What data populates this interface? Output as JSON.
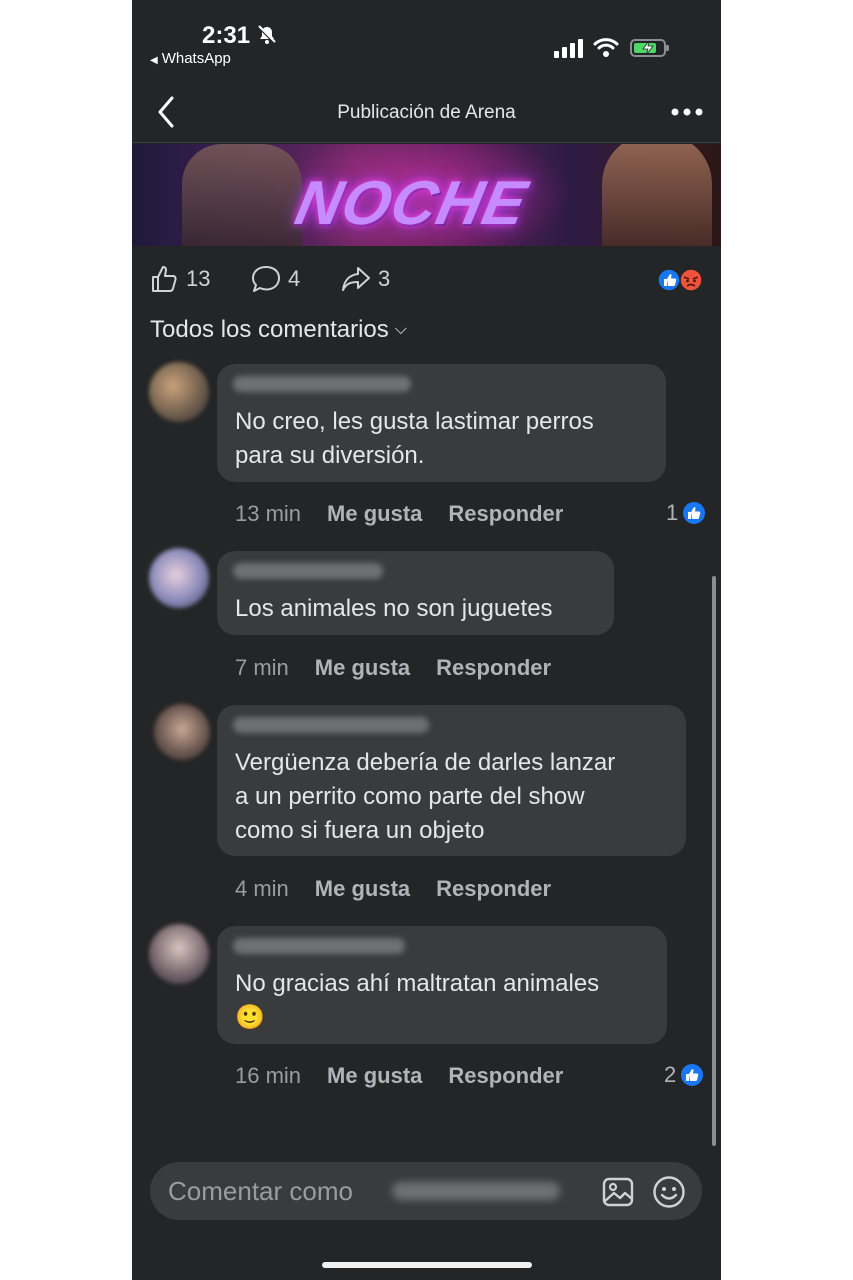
{
  "status_bar": {
    "time": "2:31",
    "back_app": "WhatsApp"
  },
  "header": {
    "title": "Publicación de Arena"
  },
  "banner": {
    "text": "NOCHE"
  },
  "stats": {
    "likes": "13",
    "comments": "4",
    "shares": "3"
  },
  "filter": {
    "label": "Todos los comentarios"
  },
  "actions": {
    "like": "Me gusta",
    "reply": "Responder"
  },
  "comments": [
    {
      "text": "No creo, les gusta lastimar perros\npara su diversión.",
      "time": "13 min",
      "likes": "1"
    },
    {
      "text": "Los animales no son juguetes",
      "time": "7 min",
      "likes": ""
    },
    {
      "text": "Vergüenza debería de darles lanzar\na un perrito como parte del show\ncomo si fuera un objeto",
      "time": "4 min",
      "likes": ""
    },
    {
      "text": "No gracias ahí maltratan animales\n🙂",
      "time": "16 min",
      "likes": "2"
    }
  ],
  "composer": {
    "placeholder": "Comentar como"
  },
  "colors": {
    "background": "#242526",
    "bubble": "#3a3b3c",
    "like_blue": "#1877f2",
    "angry_orange": "#f0533b"
  },
  "icons": [
    "bell-slash-icon",
    "signal-icon",
    "wifi-icon",
    "battery-charging-icon",
    "back-chevron-icon",
    "more-icon",
    "like-icon",
    "comment-icon",
    "share-icon",
    "like-reaction-icon",
    "angry-reaction-icon",
    "photo-icon",
    "emoji-icon"
  ]
}
